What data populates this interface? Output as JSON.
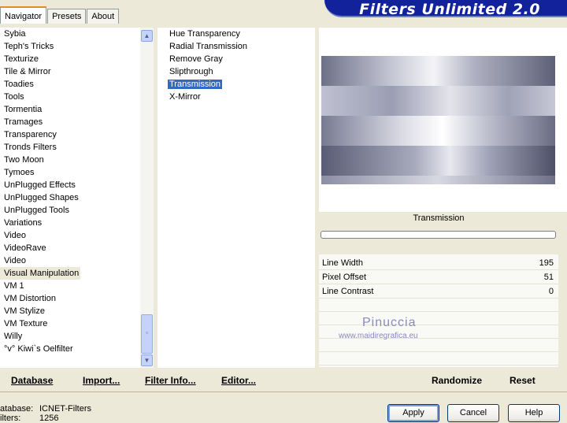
{
  "tabs": [
    "Navigator",
    "Presets",
    "About"
  ],
  "banner_title": "Filters Unlimited 2.0",
  "categories": [
    "Sybia",
    "Teph's Tricks",
    "Texturize",
    "Tile & Mirror",
    "Toadies",
    "Tools",
    "Tormentia",
    "Tramages",
    "Transparency",
    "Tronds Filters",
    "Two Moon",
    "Tymoes",
    "UnPlugged Effects",
    "UnPlugged Shapes",
    "UnPlugged Tools",
    "Variations",
    "Video",
    "VideoRave",
    "Video",
    "Visual Manipulation",
    "VM 1",
    "VM Distortion",
    "VM Stylize",
    "VM Texture",
    "Willy",
    "°v° Kiwi`s Oelfilter"
  ],
  "selected_category": "Visual Manipulation",
  "filters": [
    "Hue Transparency",
    "Radial Transmission",
    "Remove Gray",
    "Slipthrough",
    "Transmission",
    "X-Mirror"
  ],
  "selected_filter": "Transmission",
  "preview_label": "Transmission",
  "params": [
    {
      "label": "Line Width",
      "value": "195"
    },
    {
      "label": "Pixel Offset",
      "value": "51"
    },
    {
      "label": "Line Contrast",
      "value": "0"
    }
  ],
  "watermark": {
    "name": "Pinuccia",
    "url": "www.maidiregrafica.eu"
  },
  "links": {
    "database": "Database",
    "import": "Import...",
    "filter_info": "Filter Info...",
    "editor": "Editor...",
    "randomize": "Randomize",
    "reset": "Reset"
  },
  "status": {
    "database_label": "atabase:",
    "database_value": "ICNET-Filters",
    "filters_label": "ilters:",
    "filters_value": "1256"
  },
  "buttons": {
    "apply": "Apply",
    "cancel": "Cancel",
    "help": "Help"
  },
  "colors": {
    "banner": "#11229a",
    "selection": "#316ac5",
    "background": "#ece9d8"
  },
  "icons": {
    "scroll_up": "chevron-up-icon",
    "scroll_down": "chevron-down-icon"
  }
}
